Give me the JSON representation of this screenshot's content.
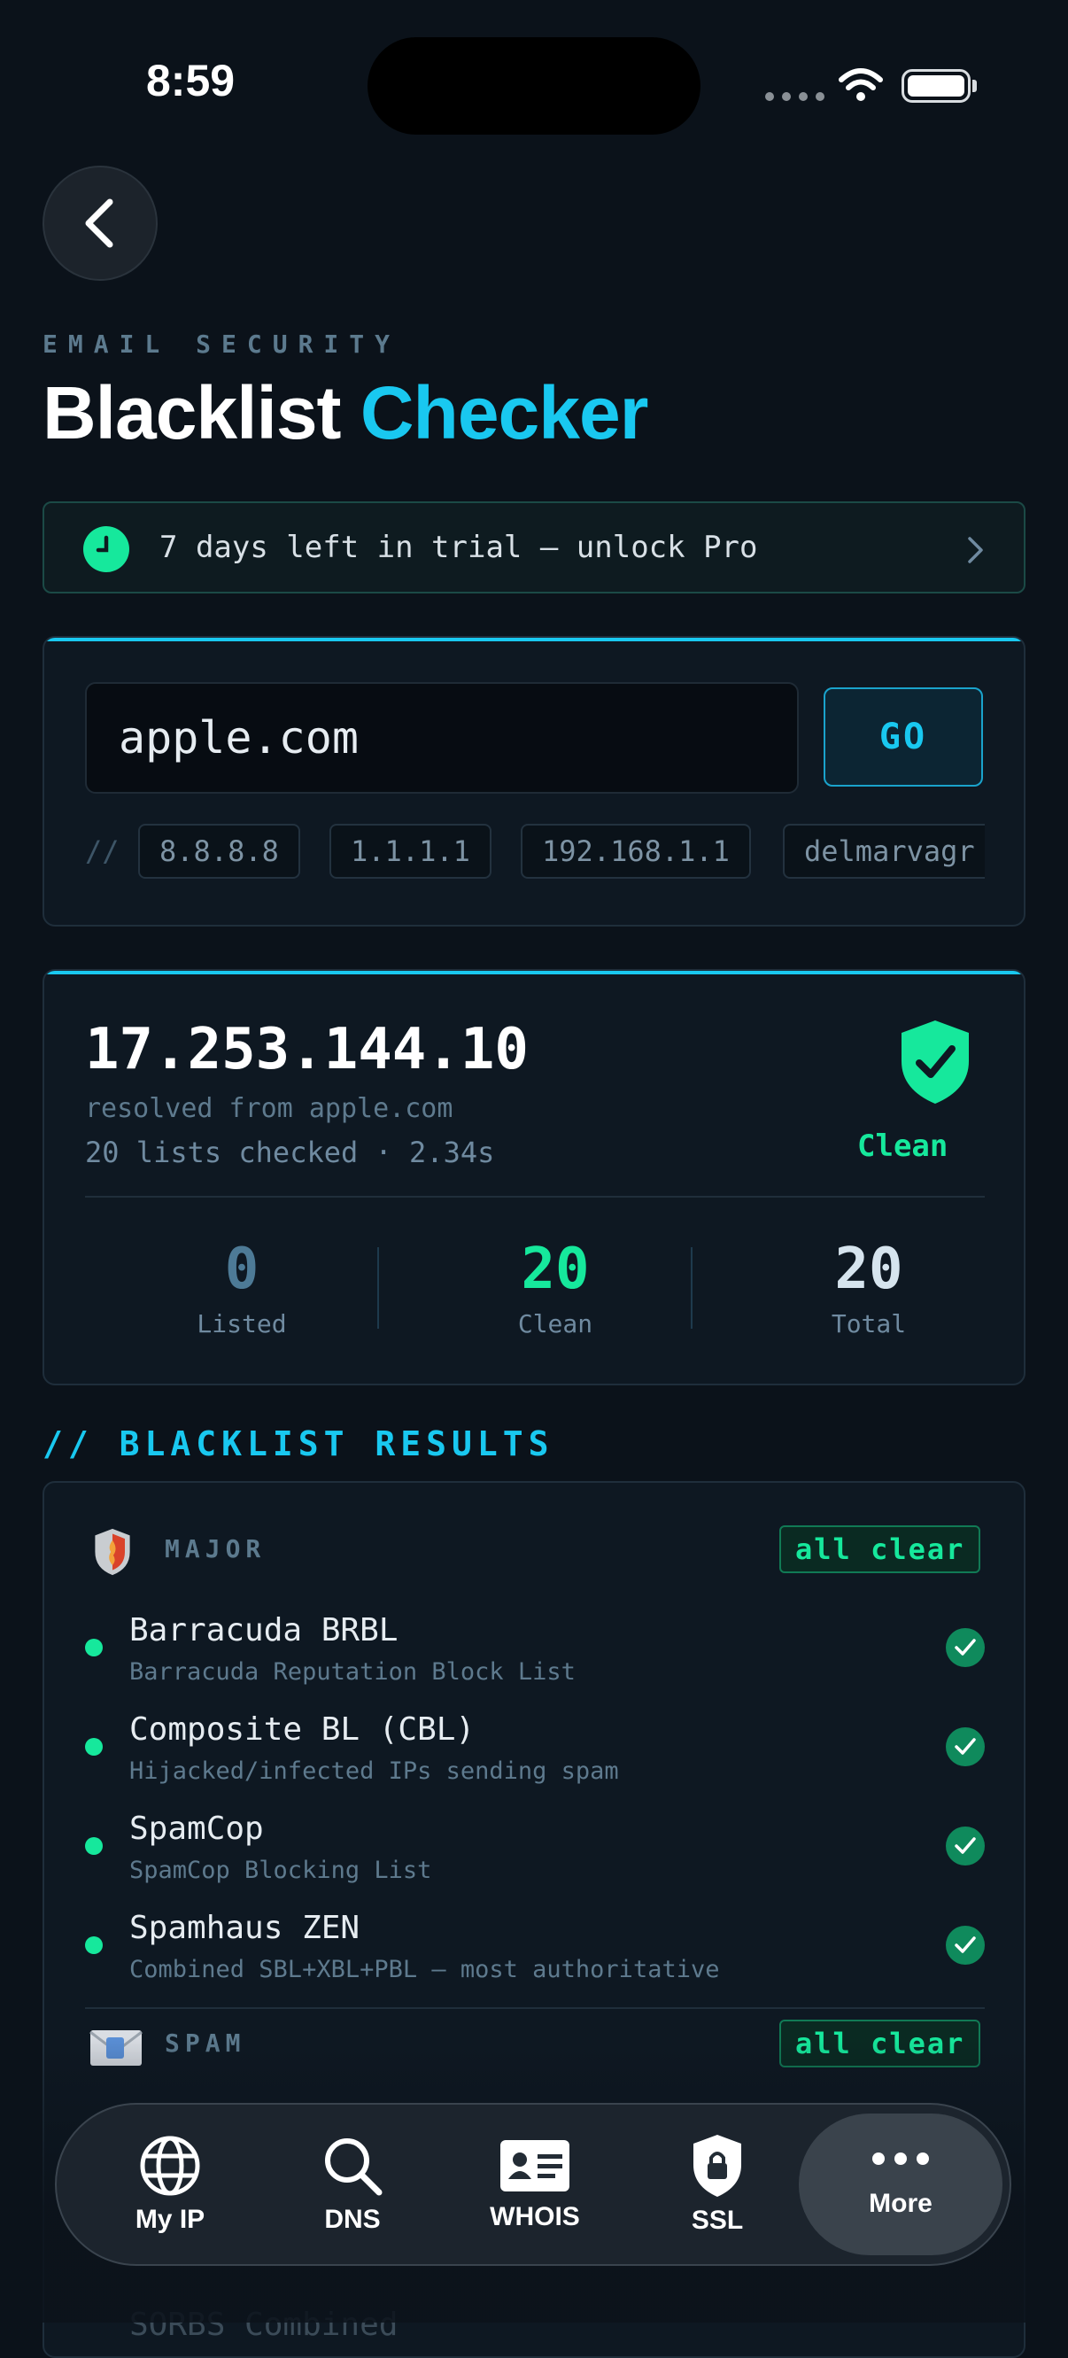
{
  "status_bar": {
    "time": "8:59"
  },
  "header": {
    "eyebrow": "EMAIL SECURITY",
    "title_main": "Blacklist",
    "title_accent": "Checker"
  },
  "trial": {
    "text": "7 days left in trial — unlock Pro"
  },
  "search": {
    "value": "apple.com",
    "go_label": "GO",
    "chips_prefix": "//",
    "chips": [
      "8.8.8.8",
      "1.1.1.1",
      "192.168.1.1",
      "delmarvagr"
    ]
  },
  "result": {
    "ip": "17.253.144.10",
    "resolved": "resolved from apple.com",
    "checked": "20 lists checked · 2.34s",
    "status": "Clean",
    "stats": [
      {
        "value": "0",
        "label": "Listed"
      },
      {
        "value": "20",
        "label": "Clean"
      },
      {
        "value": "20",
        "label": "Total"
      }
    ]
  },
  "section_title": "// BLACKLIST RESULTS",
  "groups": [
    {
      "name": "MAJOR",
      "badge": "all clear",
      "items": [
        {
          "name": "Barracuda BRBL",
          "desc": "Barracuda Reputation Block List"
        },
        {
          "name": "Composite BL (CBL)",
          "desc": "Hijacked/infected IPs sending spam"
        },
        {
          "name": "SpamCop",
          "desc": "SpamCop Blocking List"
        },
        {
          "name": "Spamhaus ZEN",
          "desc": "Combined SBL+XBL+PBL — most authoritative"
        }
      ]
    },
    {
      "name": "SPAM",
      "badge": "all clear",
      "items": [
        {
          "name": "SORBS Combined",
          "desc": ""
        }
      ]
    }
  ],
  "tabs": [
    {
      "label": "My IP",
      "icon": "globe-icon"
    },
    {
      "label": "DNS",
      "icon": "search-icon"
    },
    {
      "label": "WHOIS",
      "icon": "id-card-icon"
    },
    {
      "label": "SSL",
      "icon": "lock-shield-icon"
    },
    {
      "label": "More",
      "icon": "more-icon"
    }
  ],
  "colors": {
    "accent": "#19c8f0",
    "success": "#16e89c",
    "background": "#0b121a"
  }
}
